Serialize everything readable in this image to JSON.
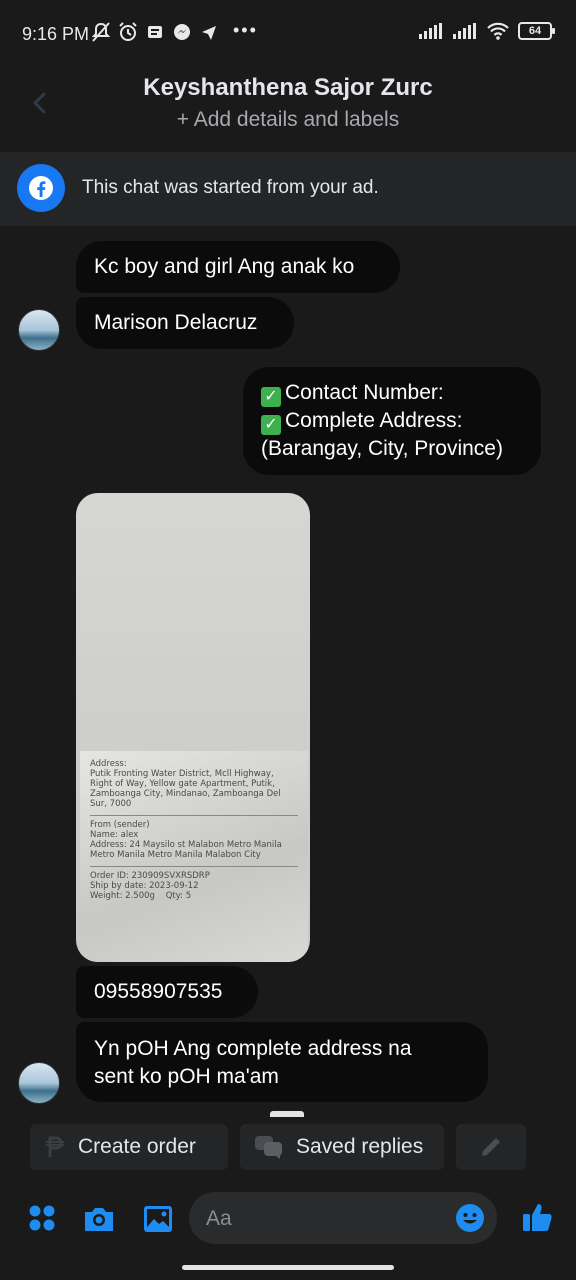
{
  "status_bar": {
    "time": "9:16 PM",
    "more": "•••",
    "battery": "64"
  },
  "header": {
    "title": "Keyshanthena Sajor Zurc",
    "subtitle": "+ Add details and labels"
  },
  "ad_banner": {
    "text": "This chat was started from your ad."
  },
  "messages": [
    {
      "direction": "incoming",
      "text": "Kc boy and girl Ang anak ko"
    },
    {
      "direction": "incoming",
      "text": "Marison Delacruz"
    },
    {
      "direction": "outgoing",
      "lines": [
        "Contact Number:",
        "Complete Address:",
        "(Barangay, City, Province)"
      ]
    },
    {
      "direction": "incoming",
      "type": "image"
    },
    {
      "direction": "incoming",
      "text": "09558907535"
    },
    {
      "direction": "incoming",
      "lines": [
        "Yn pOH Ang complete address na",
        "sent ko pOH ma'am"
      ]
    }
  ],
  "quick_actions": {
    "create_order": "Create order",
    "saved_replies": "Saved replies"
  },
  "composer": {
    "placeholder": "Aa"
  },
  "colors": {
    "background": "#1a1a1a",
    "bubble": "#0b0b0b",
    "accent": "#1877f2"
  }
}
